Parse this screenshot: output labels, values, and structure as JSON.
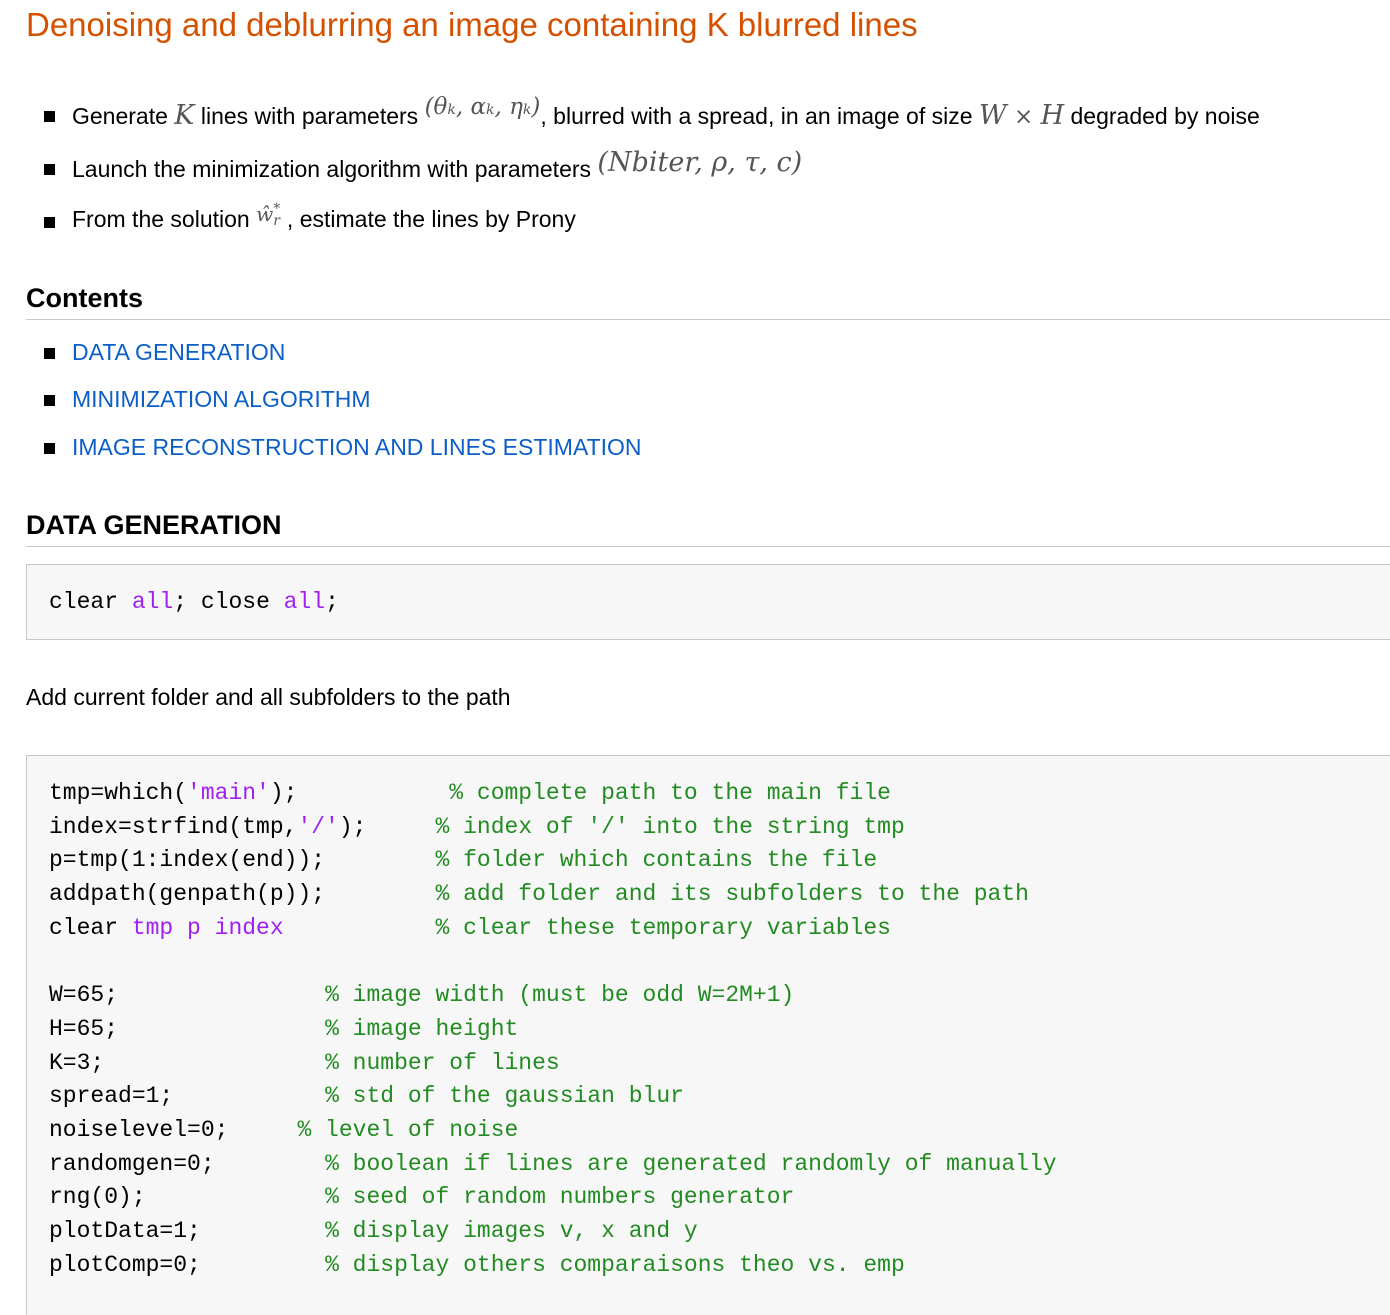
{
  "title": "Denoising and deblurring an image containing K blurred lines",
  "intro": {
    "b1": {
      "pre": "Generate ",
      "K": "K",
      "mid": " lines with parameters ",
      "params": "(θ",
      "theta_sub": "k",
      "alpha": ", α",
      "alpha_sub": "k",
      "eta": ", η",
      "eta_sub": "k",
      "close": ")",
      "post": ", blurred with a spread, in an image of size ",
      "W": "W",
      "times": " × ",
      "H": "H",
      "end": " degraded by noise"
    },
    "b2": {
      "pre": "Launch the minimization algorithm with parameters ",
      "params": "(Nbiter, ρ, τ, c)"
    },
    "b3": {
      "pre": "From the solution ",
      "w": "ŵ",
      "w_sup": "*",
      "w_sub": "r",
      "post": ", estimate the lines by Prony"
    }
  },
  "contents": {
    "heading": "Contents",
    "items": [
      "DATA GENERATION",
      "MINIMIZATION ALGORITHM",
      "IMAGE RECONSTRUCTION AND LINES ESTIMATION"
    ]
  },
  "section1": {
    "heading": "DATA GENERATION",
    "code1": {
      "clear": "clear ",
      "all1": "all",
      "sep": "; close ",
      "all2": "all",
      "end": ";"
    },
    "paragraph": "Add current folder and all subfolders to the path",
    "code2": {
      "l1_code": "tmp=which(",
      "l1_str": "'main'",
      "l1_end": ");",
      "l1_pad": "           ",
      "l1_cm": "% complete path to the main file",
      "l2_code": "index=strfind(tmp,",
      "l2_str": "'/'",
      "l2_end": ");",
      "l2_pad": "     ",
      "l2_cm": "% index of '/' into the string tmp",
      "l3_code": "p=tmp(1:index(end));",
      "l3_pad": "        ",
      "l3_cm": "% folder which contains the file",
      "l4_code": "addpath(genpath(p));",
      "l4_pad": "        ",
      "l4_cm": "% add folder and its subfolders to the path",
      "l5_code": "clear ",
      "l5_kw": "tmp p index",
      "l5_pad": "           ",
      "l5_cm": "% clear these temporary variables",
      "v1_code": "W=65;",
      "v1_pad": "               ",
      "v1_cm": "% image width (must be odd W=2M+1)",
      "v2_code": "H=65;",
      "v2_pad": "               ",
      "v2_cm": "% image height",
      "v3_code": "K=3;",
      "v3_pad": "                ",
      "v3_cm": "% number of lines",
      "v4_code": "spread=1;",
      "v4_pad": "           ",
      "v4_cm": "% std of the gaussian blur",
      "v5_code": "noiselevel=0;",
      "v5_pad": "     ",
      "v5_cm": "% level of noise",
      "v6_code": "randomgen=0;",
      "v6_pad": "        ",
      "v6_cm": "% boolean if lines are generated randomly of manually",
      "v7_code": "rng(0);",
      "v7_pad": "             ",
      "v7_cm": "% seed of random numbers generator",
      "v8_code": "plotData=1;",
      "v8_pad": "         ",
      "v8_cm": "% display images v, x and y",
      "v9_code": "plotComp=0;",
      "v9_pad": "         ",
      "v9_cm": "% display others comparaisons theo vs. emp"
    }
  }
}
